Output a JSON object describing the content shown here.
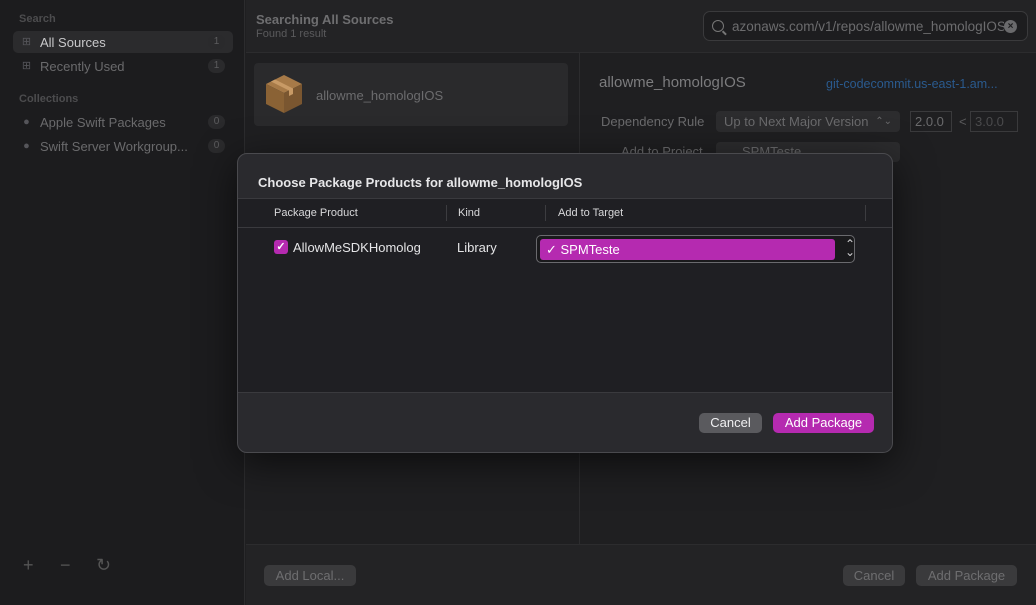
{
  "sidebar": {
    "search_heading": "Search",
    "search_items": [
      {
        "label": "All Sources",
        "count": "1",
        "icon": "grid-icon"
      },
      {
        "label": "Recently Used",
        "count": "1",
        "icon": "grid-icon"
      }
    ],
    "collections_heading": "Collections",
    "collection_items": [
      {
        "label": "Apple Swift Packages",
        "count": "0",
        "icon": "apple-icon"
      },
      {
        "label": "Swift Server Workgroup...",
        "count": "0",
        "icon": "apple-icon"
      }
    ],
    "footer": {
      "add": "+",
      "remove": "−",
      "refresh": "↻"
    }
  },
  "header": {
    "title": "Searching All Sources",
    "subtitle": "Found 1 result",
    "search_value": "azonaws.com/v1/repos/allowme_homologIOS"
  },
  "results": [
    {
      "name": "allowme_homologIOS"
    }
  ],
  "detail": {
    "title": "allowme_homologIOS",
    "link": "git-codecommit.us-east-1.am...",
    "dependency_rule_label": "Dependency Rule",
    "dependency_rule_value": "Up to Next Major Version",
    "version_from": "2.0.0",
    "lt": "<",
    "version_to": "3.0.0",
    "add_to_project_label": "Add to Project",
    "add_to_project_value": "SPMTeste"
  },
  "bottom": {
    "add_local": "Add Local...",
    "cancel": "Cancel",
    "add_package": "Add Package"
  },
  "modal": {
    "title": "Choose Package Products for allowme_homologIOS",
    "columns": [
      "Package Product",
      "Kind",
      "Add to Target"
    ],
    "rows": [
      {
        "checked": true,
        "product": "AllowMeSDKHomolog",
        "kind": "Library",
        "target": "SPMTeste"
      }
    ],
    "cancel": "Cancel",
    "add_package": "Add Package"
  },
  "colors": {
    "accent": "#b52ab0",
    "link": "#2a5a8e"
  }
}
